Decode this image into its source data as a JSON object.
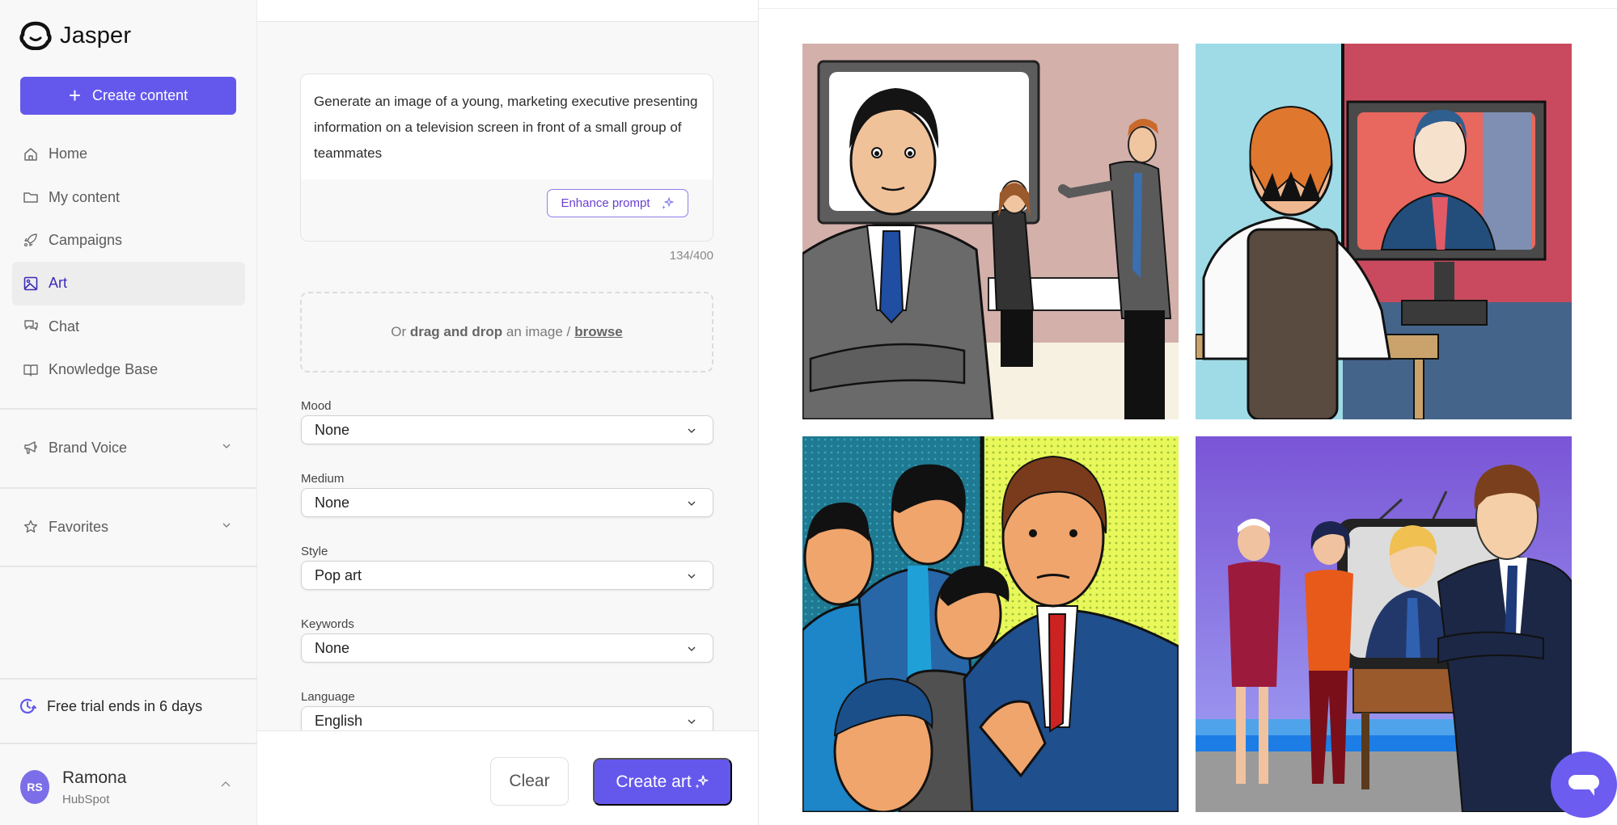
{
  "app": {
    "brand": "Jasper",
    "accent_color": "#6458ec"
  },
  "sidebar": {
    "create_button": "Create content",
    "nav_items": [
      {
        "label": "Home",
        "icon": "home-icon",
        "active": false
      },
      {
        "label": "My content",
        "icon": "folder-icon",
        "active": false
      },
      {
        "label": "Campaigns",
        "icon": "rocket-icon",
        "active": false
      },
      {
        "label": "Art",
        "icon": "image-icon",
        "active": true
      },
      {
        "label": "Chat",
        "icon": "chat-icon",
        "active": false
      },
      {
        "label": "Knowledge Base",
        "icon": "book-icon",
        "active": false
      }
    ],
    "sections": [
      {
        "label": "Brand Voice",
        "icon": "megaphone-icon"
      },
      {
        "label": "Favorites",
        "icon": "star-icon"
      }
    ],
    "trial_text": "Free trial ends in 6 days",
    "user": {
      "initials": "RS",
      "name": "Ramona",
      "org": "HubSpot"
    }
  },
  "form": {
    "prompt_text": "Generate an image of a young, marketing executive presenting information on a television screen in front of a small group of teammates",
    "enhance_button": "Enhance prompt",
    "char_count": "134/400",
    "dropzone": {
      "prefix": "Or",
      "bold": "drag and drop",
      "middle": "an image /",
      "link": "browse"
    },
    "fields": [
      {
        "label": "Mood",
        "value": "None"
      },
      {
        "label": "Medium",
        "value": "None"
      },
      {
        "label": "Style",
        "value": "Pop art"
      },
      {
        "label": "Keywords",
        "value": "None"
      },
      {
        "label": "Language",
        "value": "English"
      }
    ],
    "clear_button": "Clear",
    "create_art_button": "Create art"
  },
  "results": {
    "images": [
      {
        "description": "Executive in grey suit with arms crossed in front of TV screen, woman and man presenting behind"
      },
      {
        "description": "Man seen from behind at desk watching presenter on TV screen, red and blue background"
      },
      {
        "description": "Pop art halftone scene of presenter in blue suit pointing, group of men watching"
      },
      {
        "description": "Man in navy suit with arms crossed beside retro TV, two women standing on purple background"
      }
    ]
  }
}
